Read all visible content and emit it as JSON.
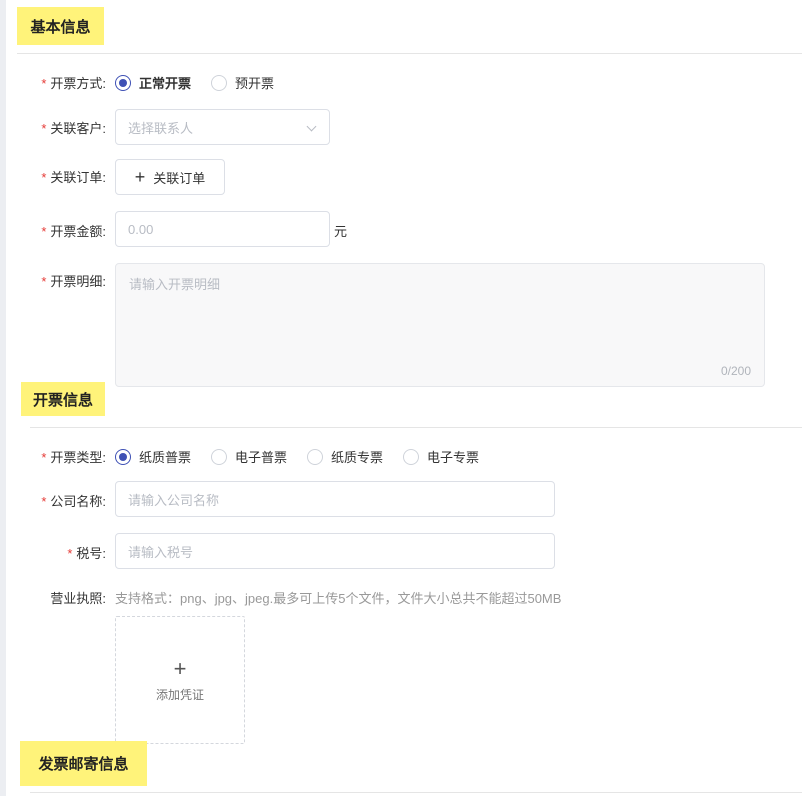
{
  "sections": {
    "basic": "基本信息",
    "invoice": "开票信息",
    "mailing": "发票邮寄信息"
  },
  "basic": {
    "method": {
      "label": "开票方式:",
      "options": [
        "正常开票",
        "预开票"
      ],
      "selected": "正常开票"
    },
    "customer": {
      "label": "关联客户:",
      "placeholder": "选择联系人"
    },
    "order": {
      "label": "关联订单:",
      "button": "关联订单"
    },
    "amount": {
      "label": "开票金额:",
      "placeholder": "0.00",
      "unit": "元"
    },
    "detail": {
      "label": "开票明细:",
      "placeholder": "请输入开票明细",
      "counter": "0/200"
    }
  },
  "invoice": {
    "type": {
      "label": "开票类型:",
      "options": [
        "纸质普票",
        "电子普票",
        "纸质专票",
        "电子专票"
      ],
      "selected": "纸质普票"
    },
    "company": {
      "label": "公司名称:",
      "placeholder": "请输入公司名称"
    },
    "tax": {
      "label": "税号:",
      "placeholder": "请输入税号"
    },
    "license": {
      "label": "营业执照:",
      "hint": "支持格式：png、jpg、jpeg.最多可上传5个文件，文件大小总共不能超过50MB",
      "upload": "添加凭证"
    }
  },
  "required_mark": "*",
  "colors": {
    "highlight": "#fff37a",
    "primary": "#3f51b5",
    "required": "#e53935"
  }
}
